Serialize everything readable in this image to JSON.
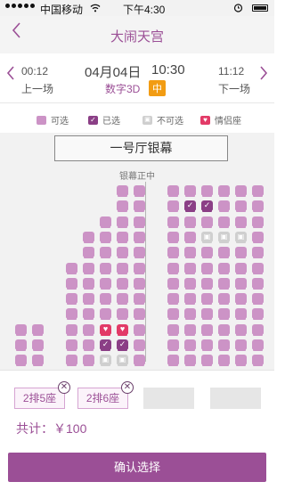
{
  "status_bar": {
    "carrier": "中国移动",
    "wifi_icon": "wifi-icon",
    "time": "下午4:30",
    "alarm_icon": "alarm-icon",
    "battery_icon": "battery-icon"
  },
  "nav": {
    "title": "大闹天宫",
    "back_icon": "chevron-left-icon"
  },
  "showtime": {
    "prev_time": "00:12",
    "prev_label": "上一场",
    "date": "04月04日",
    "time": "10:30",
    "format": "数字3D",
    "language": "中",
    "next_time": "11:12",
    "next_label": "下一场"
  },
  "legend": [
    {
      "label": "可选",
      "state": "available",
      "color": "#cc93c6"
    },
    {
      "label": "已选",
      "state": "selected",
      "color": "#8b3f86"
    },
    {
      "label": "不可选",
      "state": "unavailable",
      "color": "#cfcfcf"
    },
    {
      "label": "情侣座",
      "state": "couple",
      "color": "#e23a67"
    }
  ],
  "hall": {
    "screen_name": "一号厅银幕",
    "screen_center_label": "银幕正中"
  },
  "seat_map": {
    "columns": 15,
    "rows": [
      {
        "seats": "......AA.AAAAAAA"
      },
      {
        "seats": "......AA.ASSAAAA"
      },
      {
        "seats": ".....AAA.AAAAAAA"
      },
      {
        "seats": "....AAAA.AAXXXAA"
      },
      {
        "seats": "....AAAA.AAAAAAA"
      },
      {
        "seats": "...AAAAA.AAAAAAA"
      },
      {
        "seats": "...AAAAA.AAAAAAA"
      },
      {
        "seats": "...AAAAA.AAAAAAA"
      },
      {
        "seats": "...AAAAA.AAAAAAA"
      },
      {
        "seats": "AA.AACCA.AAAAAAA"
      },
      {
        "seats": "AA.AASSA.AAAAAAA"
      },
      {
        "seats": "AA.AAXXA.AAAAAAA"
      }
    ]
  },
  "picks": {
    "chips": [
      "2排5座",
      "2排6座"
    ],
    "empty_slots": 2,
    "total_label": "共计：",
    "total_value": "￥100"
  },
  "confirm_label": "确认选择"
}
